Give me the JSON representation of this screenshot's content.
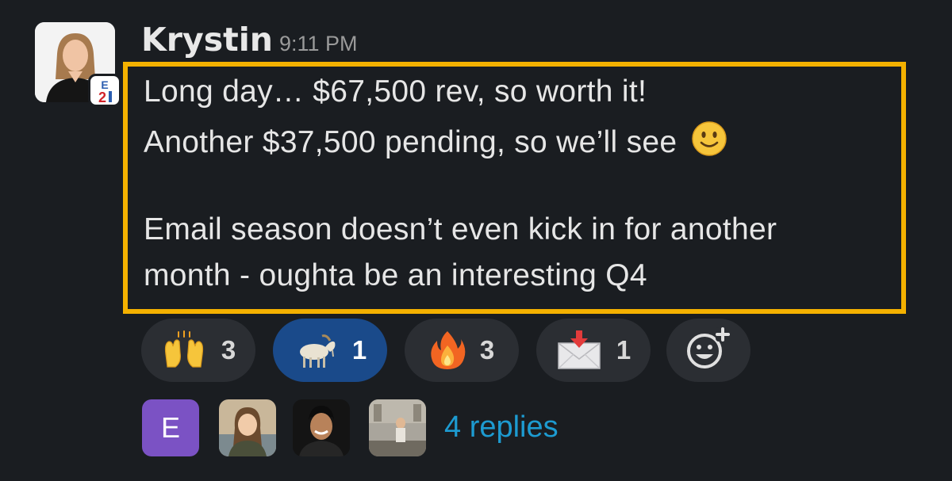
{
  "message": {
    "author": "Krystin",
    "timestamp": "9:11 PM",
    "lines": [
      "Long day… $67,500 rev, so worth it!",
      "Another $37,500 pending, so we’ll see",
      "Email season doesn’t even kick in for another",
      "month - oughta be an interesting Q4"
    ],
    "inline_emoji": "slightly-smiling-face"
  },
  "highlight_color": "#f4b100",
  "reactions": [
    {
      "icon": "raising-hands",
      "count": "3",
      "active": false
    },
    {
      "icon": "goat",
      "count": "1",
      "active": true
    },
    {
      "icon": "fire",
      "count": "3",
      "active": false
    },
    {
      "icon": "incoming-envelope",
      "count": "1",
      "active": false
    }
  ],
  "add_reaction_icon": "add-reaction",
  "thread": {
    "repliers": [
      {
        "type": "letter",
        "letter": "E"
      },
      {
        "type": "photo"
      },
      {
        "type": "photo"
      },
      {
        "type": "photo"
      }
    ],
    "replies_label": "4 replies"
  },
  "colors": {
    "background": "#1a1d21",
    "reaction_bg": "#2b2e33",
    "reaction_active_bg": "#1a4a8a",
    "link": "#1d9bd1",
    "replier_letter_bg": "#7b52c4"
  }
}
